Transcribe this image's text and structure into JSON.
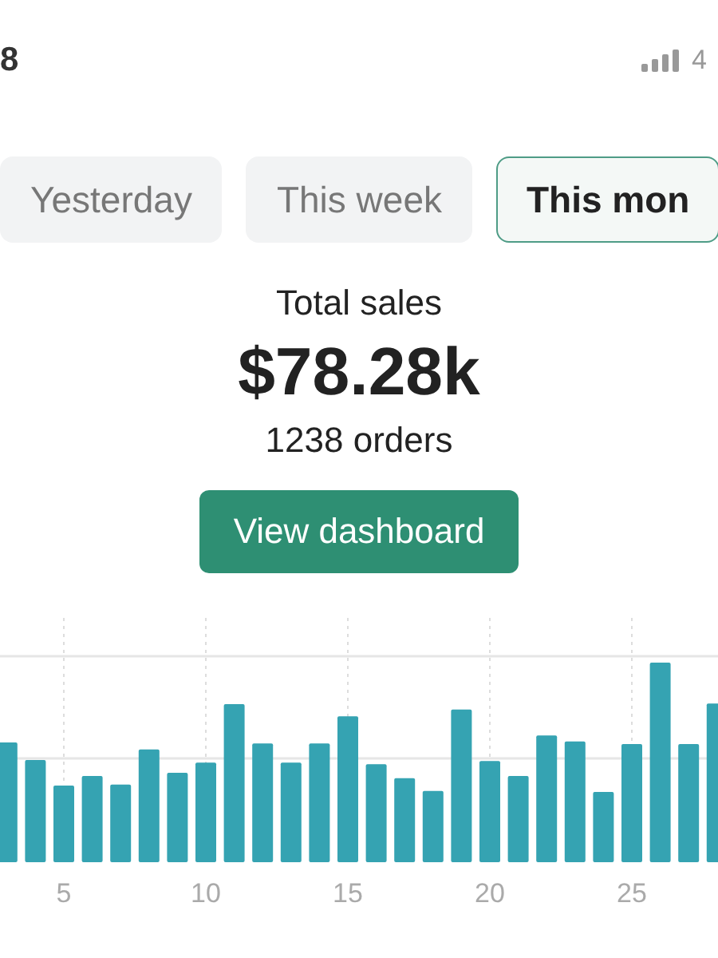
{
  "status_bar": {
    "time": "8",
    "network": "4"
  },
  "tabs": [
    {
      "label": "Yesterday",
      "selected": false
    },
    {
      "label": "This week",
      "selected": false
    },
    {
      "label": "This mon",
      "selected": true
    }
  ],
  "summary": {
    "title": "Total sales",
    "amount": "$78.28k",
    "orders": "1238 orders",
    "button": "View dashboard"
  },
  "chart": {
    "x_labels": [
      "5",
      "10",
      "15",
      "20",
      "25"
    ]
  }
}
